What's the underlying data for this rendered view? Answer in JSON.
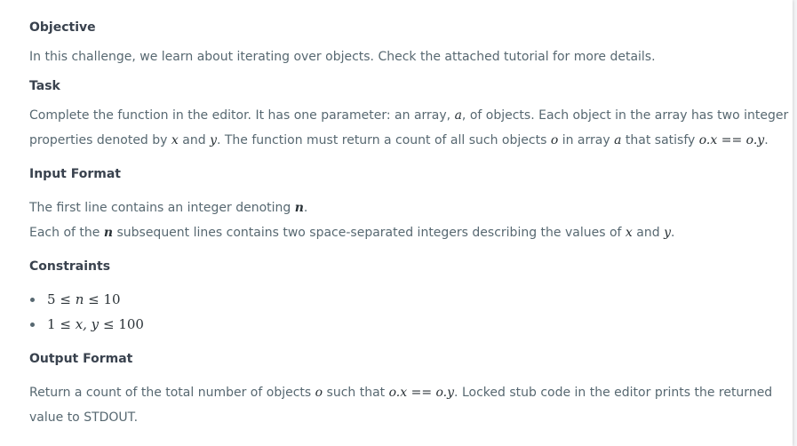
{
  "objective": {
    "heading": "Objective",
    "text": "In this challenge, we learn about iterating over objects. Check the attached tutorial for more details."
  },
  "task": {
    "heading": "Task",
    "line1": [
      "Complete the function in the editor. It has one parameter: an array, ",
      "a",
      ", of objects. Each object in the array has two integer"
    ],
    "line2": [
      "properties denoted by ",
      "x",
      " and ",
      "y",
      ". The function must return a count of all such objects ",
      "o",
      " in array ",
      "a",
      " that satisfy ",
      "o.x == o.y",
      "."
    ]
  },
  "input_format": {
    "heading": "Input Format",
    "line1": [
      "The first line contains an integer denoting ",
      "n",
      "."
    ],
    "line2": [
      "Each of the ",
      "n",
      " subsequent lines contains two space-separated integers describing the values of ",
      "x",
      " and ",
      "y",
      "."
    ]
  },
  "constraints": {
    "heading": "Constraints",
    "items": [
      {
        "a": "5",
        "op1": "≤",
        "v": "n",
        "op2": "≤",
        "b": "10"
      },
      {
        "a": "1",
        "op1": "≤",
        "v": "x, y",
        "op2": "≤",
        "b": "100"
      }
    ]
  },
  "output_format": {
    "heading": "Output Format",
    "line1": [
      "Return a count of the total number of objects ",
      "o",
      " such that ",
      "o.x == o.y",
      ". Locked stub code in the editor prints the returned"
    ],
    "line2": "value to STDOUT."
  }
}
